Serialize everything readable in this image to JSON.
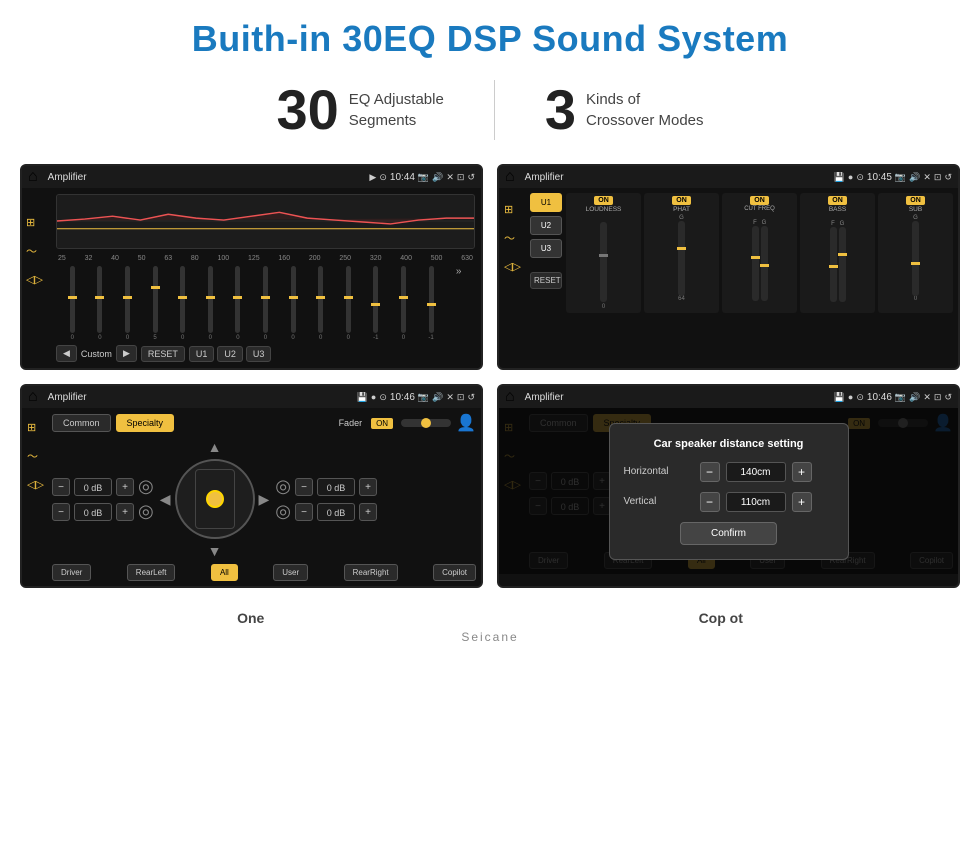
{
  "page": {
    "title": "Buith-in 30EQ DSP Sound System",
    "watermark": "Seicane"
  },
  "stats": {
    "eq_number": "30",
    "eq_label_line1": "EQ Adjustable",
    "eq_label_line2": "Segments",
    "crossover_number": "3",
    "crossover_label_line1": "Kinds of",
    "crossover_label_line2": "Crossover Modes"
  },
  "screen1": {
    "title": "Amplifier",
    "time": "10:44",
    "custom_label": "Custom",
    "reset_btn": "RESET",
    "presets": [
      "U1",
      "U2",
      "U3"
    ],
    "freq_labels": [
      "25",
      "32",
      "40",
      "50",
      "63",
      "80",
      "100",
      "125",
      "160",
      "200",
      "250",
      "320",
      "400",
      "500",
      "630"
    ],
    "slider_vals": [
      "0",
      "0",
      "0",
      "5",
      "0",
      "0",
      "0",
      "0",
      "0",
      "0",
      "0",
      "-1",
      "0",
      "-1"
    ]
  },
  "screen2": {
    "title": "Amplifier",
    "time": "10:45",
    "presets_left": [
      "U1",
      "U2",
      "U3"
    ],
    "reset_btn": "RESET",
    "channels": [
      "LOUDNESS",
      "PHAT",
      "CUT FREQ",
      "BASS",
      "SUB"
    ],
    "on_labels": [
      "ON",
      "ON",
      "ON",
      "ON",
      "ON"
    ]
  },
  "screen3": {
    "title": "Amplifier",
    "time": "10:46",
    "common_btn": "Common",
    "specialty_btn": "Specialty",
    "fader_label": "Fader",
    "fader_on": "ON",
    "dB_values": [
      "0 dB",
      "0 dB",
      "0 dB",
      "0 dB"
    ],
    "loc_buttons": [
      "Driver",
      "RearLeft",
      "All",
      "User",
      "RearRight",
      "Copilot"
    ]
  },
  "screen4": {
    "title": "Amplifier",
    "time": "10:46",
    "common_btn": "Common",
    "specialty_btn": "Specialty",
    "dialog_title": "Car speaker distance setting",
    "horizontal_label": "Horizontal",
    "horizontal_val": "140cm",
    "vertical_label": "Vertical",
    "vertical_val": "110cm",
    "confirm_btn": "Confirm",
    "dB_values": [
      "0 dB",
      "0 dB"
    ],
    "loc_buttons": [
      "Driver",
      "RearLeft",
      "User",
      "RearRight",
      "Copilot"
    ]
  },
  "bottom_labels": {
    "one": "One",
    "copilot": "Cop ot"
  }
}
